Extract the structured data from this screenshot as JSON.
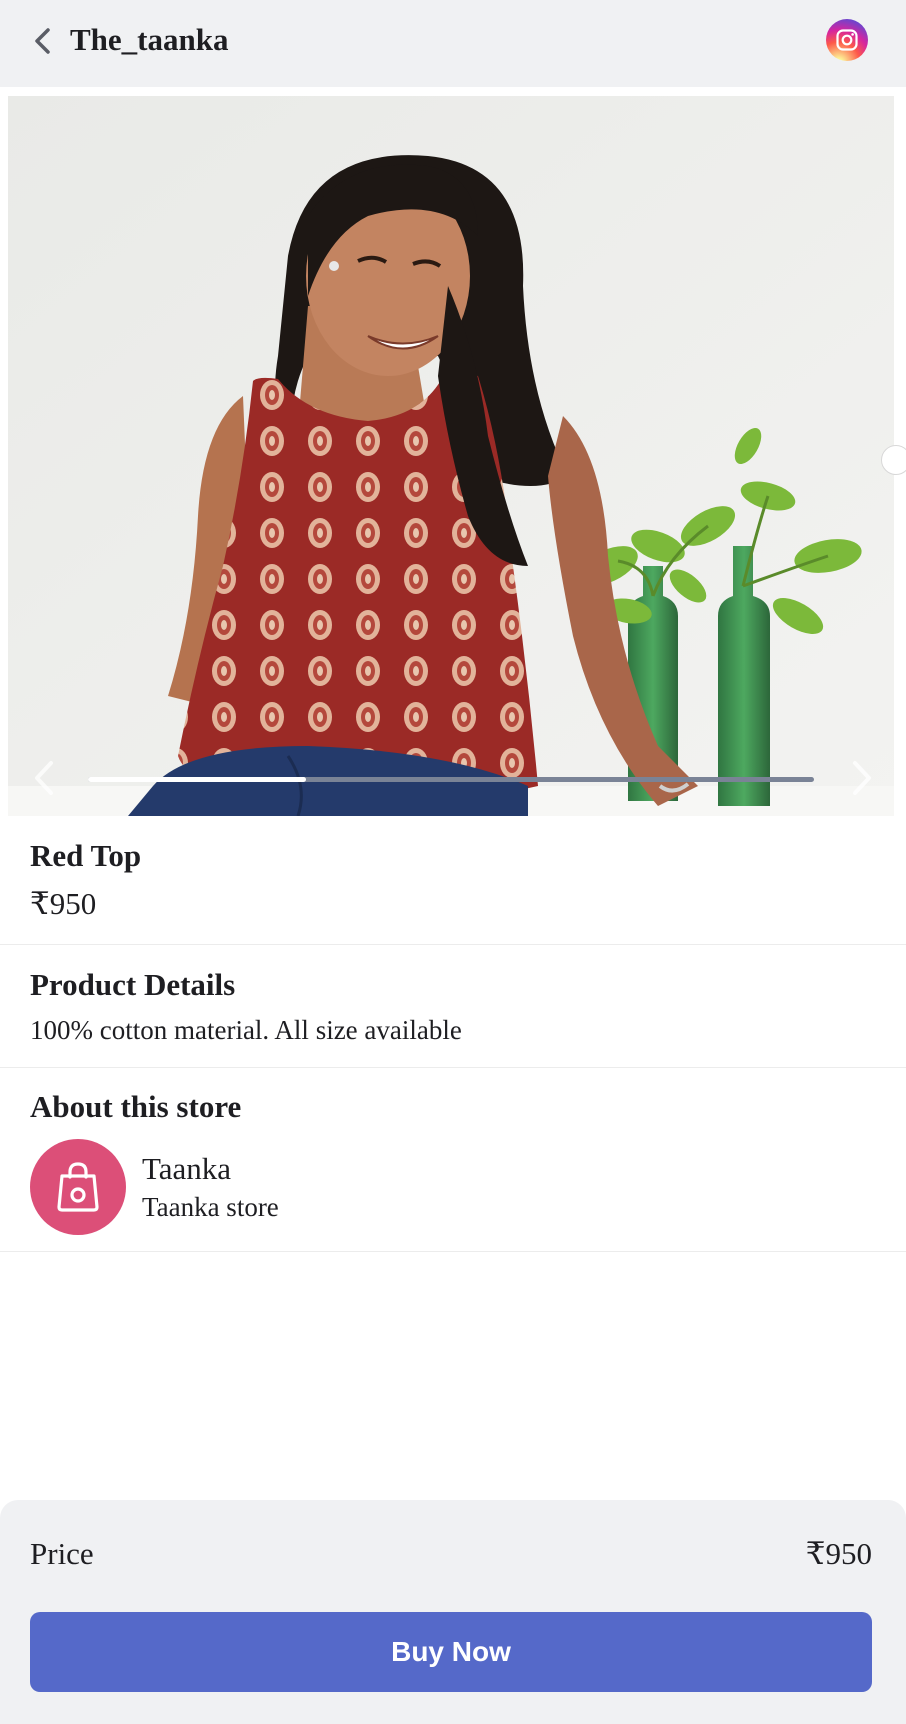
{
  "header": {
    "title": "The_taanka",
    "back_icon": "chevron-left-icon",
    "instagram_icon": "instagram-icon"
  },
  "carousel": {
    "progress": 0.3,
    "prev_icon": "chevron-left-icon",
    "next_icon": "chevron-right-icon"
  },
  "product": {
    "name": "Red Top",
    "price": "₹950"
  },
  "details": {
    "heading": "Product Details",
    "text": "100% cotton material. All size available"
  },
  "store": {
    "heading": "About this store",
    "name": "Taanka",
    "description": "Taanka store",
    "icon": "shopping-bag-icon",
    "color": "#dc4f78"
  },
  "footer": {
    "price_label": "Price",
    "price_value": "₹950",
    "buy_label": "Buy Now",
    "button_color": "#5569c9"
  }
}
